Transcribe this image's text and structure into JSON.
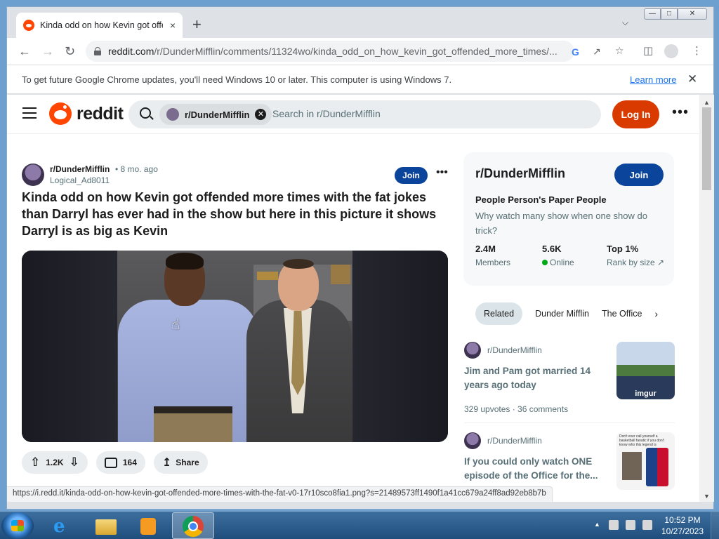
{
  "browser": {
    "tab_title": "Kinda odd on how Kevin got offe",
    "tab_close": "×",
    "new_tab": "+",
    "url_host": "reddit.com",
    "url_path": "/r/DunderMifflin/comments/11324wo/kinda_odd_on_how_kevin_got_offended_more_times/...",
    "infobar_text": "To get future Google Chrome updates, you'll need Windows 10 or later. This computer is using Windows 7.",
    "infobar_link": "Learn more",
    "status_url": "https://i.redd.it/kinda-odd-on-how-kevin-got-offended-more-times-with-the-fat-v0-17r10sco8fia1.png?s=21489573ff1490f1a41cc679a24ff8ad92eb8b7b"
  },
  "reddit": {
    "wordmark": "reddit",
    "search_chip": "r/DunderMifflin",
    "search_placeholder": "Search in r/DunderMifflin",
    "login": "Log In",
    "more": "•••"
  },
  "post": {
    "subreddit": "r/DunderMifflin",
    "age": "• 8 mo. ago",
    "author": "Logical_Ad8011",
    "join": "Join",
    "more": "•••",
    "title": "Kinda odd on how Kevin got offended more times with the fat jokes than Darryl has ever had in the show but here in this picture it shows Darryl is as big as Kevin",
    "votes": "1.2K",
    "comments": "164",
    "share": "Share"
  },
  "sidebar": {
    "name": "r/DunderMifflin",
    "join": "Join",
    "tagline": "People Person's Paper People",
    "description": "Why watch many show when one show do trick?",
    "stats": [
      {
        "value": "2.4M",
        "label": "Members"
      },
      {
        "value": "5.6K",
        "label": "Online"
      },
      {
        "value": "Top 1%",
        "label": "Rank by size ↗"
      }
    ]
  },
  "related": {
    "tabs": [
      "Related",
      "Dunder Mifflin",
      "The Office"
    ],
    "next": "›",
    "items": [
      {
        "subreddit": "r/DunderMifflin",
        "title": "Jim and Pam got married 14 years ago today",
        "meta": "329 upvotes · 36 comments",
        "thumb_label": "imgur"
      },
      {
        "subreddit": "r/DunderMifflin",
        "title": "If you could only watch ONE episode of the Office for the...",
        "thumb_text": "Don't ever call yourself a basketball fanatic if you don't know who this legend is"
      }
    ]
  },
  "taskbar": {
    "time": "10:52 PM",
    "date": "10/27/2023"
  },
  "colors": {
    "reddit_orange": "#ff4500",
    "login_button": "#d93a00",
    "join_button": "#0a449b",
    "online_dot": "#01a816"
  }
}
